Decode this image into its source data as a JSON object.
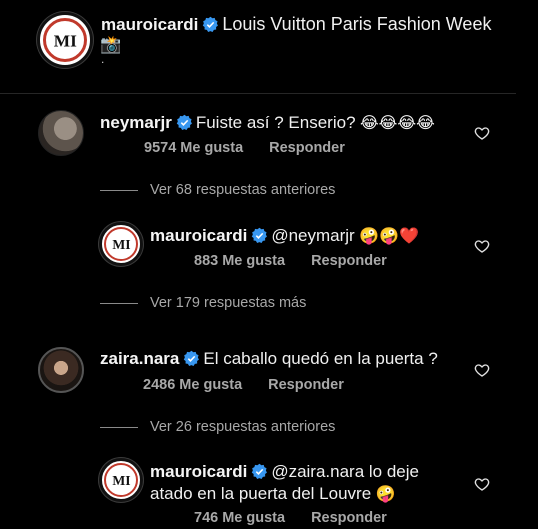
{
  "post": {
    "username": "mauroicardi",
    "caption": "Louis Vuitton Paris Fashion Week",
    "caption_emoji": "📸",
    "caption_extra": "."
  },
  "comments": [
    {
      "username": "neymarjr",
      "text": "Fuiste así ? Enserio?",
      "emoji": "😂😂😂😂",
      "likes": "9574 Me gusta",
      "reply": "Responder",
      "view_more": "Ver 68 respuestas anteriores"
    },
    {
      "username": "mauroicardi",
      "text": "@neymarjr",
      "emoji": "🤪🤪❤️",
      "likes": "883 Me gusta",
      "reply": "Responder",
      "view_more": "Ver 179 respuestas más"
    },
    {
      "username": "zaira.nara",
      "text": "El caballo quedó en la puerta ?",
      "likes": "2486 Me gusta",
      "reply": "Responder",
      "view_more": "Ver 26 respuestas anteriores"
    },
    {
      "username": "mauroicardi",
      "text_line1": "@zaira.nara lo deje",
      "text_line2": "atado en la puerta del Louvre",
      "emoji": "🤪",
      "likes": "746 Me gusta",
      "reply": "Responder"
    }
  ],
  "colors": {
    "background": "#000000",
    "verified": "#3897f0",
    "meta": "#a8a8a8",
    "logo_red": "#c0392b"
  },
  "icons": [
    "verified-badge-icon",
    "heart-icon",
    "camera-emoji-icon"
  ]
}
